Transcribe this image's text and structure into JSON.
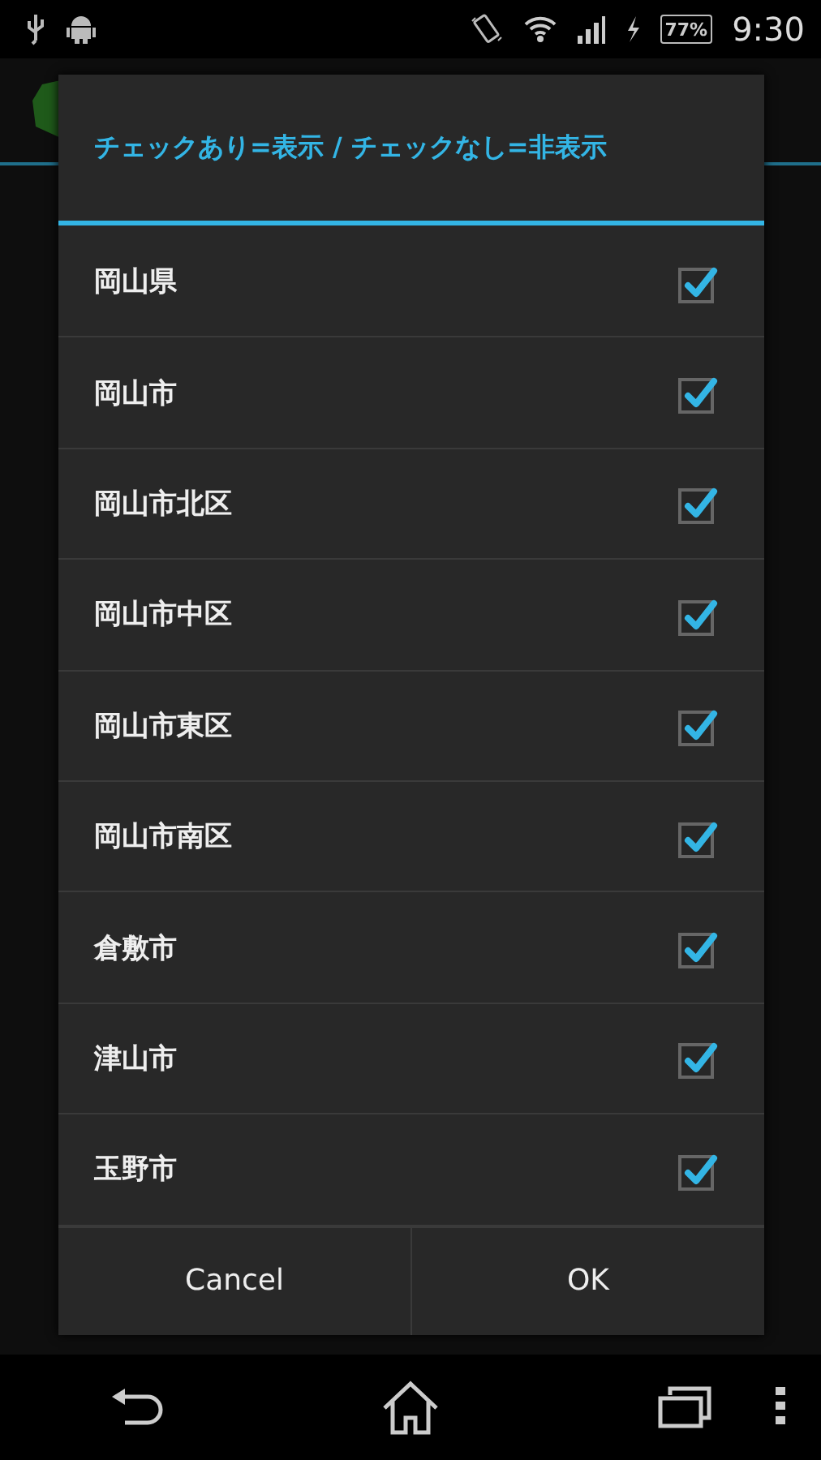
{
  "status_bar": {
    "battery": "77%",
    "time": "9:30"
  },
  "dialog": {
    "title": "チェックあり=表示 / チェックなし=非表示",
    "items": [
      {
        "label": "岡山県",
        "checked": true
      },
      {
        "label": "岡山市",
        "checked": true
      },
      {
        "label": "岡山市北区",
        "checked": true
      },
      {
        "label": "岡山市中区",
        "checked": true
      },
      {
        "label": "岡山市東区",
        "checked": true
      },
      {
        "label": "岡山市南区",
        "checked": true
      },
      {
        "label": "倉敷市",
        "checked": true
      },
      {
        "label": "津山市",
        "checked": true
      },
      {
        "label": "玉野市",
        "checked": true
      }
    ],
    "buttons": [
      "Cancel",
      "OK"
    ]
  }
}
